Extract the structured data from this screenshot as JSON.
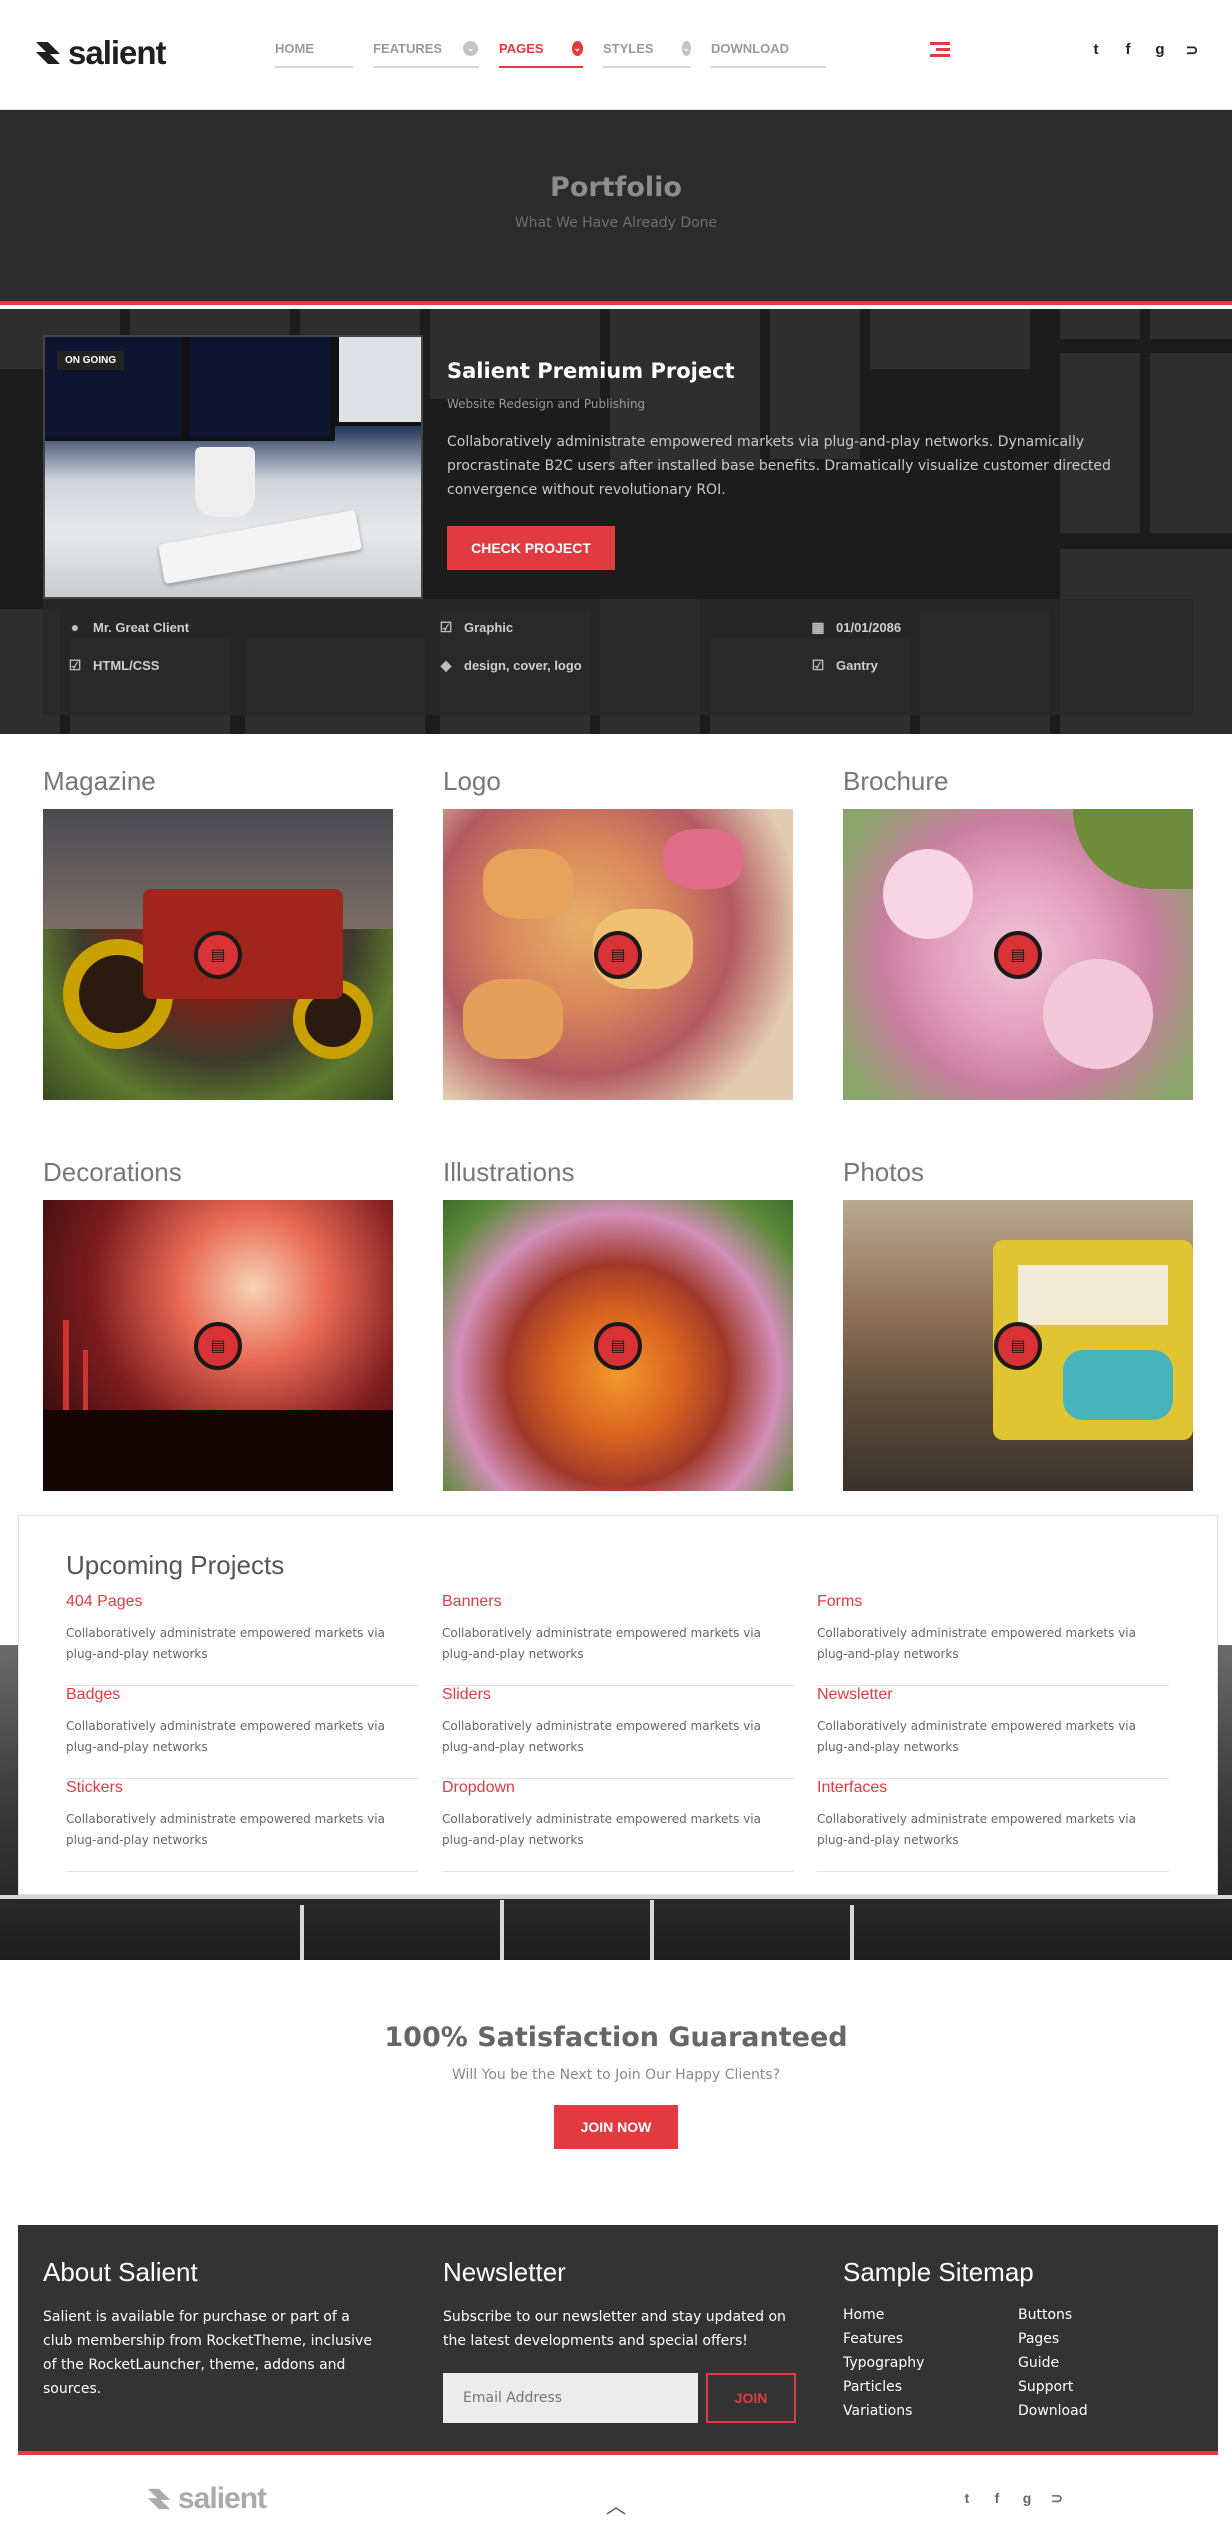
{
  "header": {
    "logo_text": "salient",
    "nav": [
      {
        "label": "HOME",
        "active": false,
        "has_dropdown": false
      },
      {
        "label": "FEATURES",
        "active": false,
        "has_dropdown": true
      },
      {
        "label": "PAGES",
        "active": true,
        "has_dropdown": true
      },
      {
        "label": "STYLES",
        "active": false,
        "has_dropdown": true
      },
      {
        "label": "DOWNLOAD",
        "active": false,
        "has_dropdown": false
      }
    ],
    "social_icons": [
      "twitter-icon",
      "facebook-icon",
      "google-plus-icon",
      "rss-icon"
    ],
    "social_glyphs": [
      "t",
      "f",
      "g",
      "⊃"
    ]
  },
  "banner": {
    "title": "Portfolio",
    "subtitle": "What We Have Already Done"
  },
  "featured": {
    "badge": "ON GOING",
    "title": "Salient Premium Project",
    "subtitle": "Website Redesign and Publishing",
    "description": "Collaboratively administrate empowered markets via plug-and-play networks. Dynamically procrastinate B2C users after installed base benefits. Dramatically visualize customer directed convergence without revolutionary ROI.",
    "button_label": "CHECK PROJECT",
    "meta": [
      {
        "icon": "user-icon",
        "text": "Mr. Great Client"
      },
      {
        "icon": "check-icon",
        "text": "Graphic"
      },
      {
        "icon": "calendar-icon",
        "text": "01/01/2086"
      },
      {
        "icon": "check-icon",
        "text": "HTML/CSS"
      },
      {
        "icon": "tag-icon",
        "text": "design, cover, logo"
      },
      {
        "icon": "check-icon",
        "text": "Gantry"
      }
    ]
  },
  "categories": [
    {
      "title": "Magazine",
      "image": "red tractor"
    },
    {
      "title": "Logo",
      "image": "candied pastries"
    },
    {
      "title": "Brochure",
      "image": "pink cherry blossoms"
    },
    {
      "title": "Decorations",
      "image": "fireworks over city"
    },
    {
      "title": "Illustrations",
      "image": "coneflower close-up"
    },
    {
      "title": "Photos",
      "image": "yellow graffiti tram"
    }
  ],
  "upcoming": {
    "title": "Upcoming Projects",
    "items": [
      {
        "title": "404 Pages",
        "desc": "Collaboratively administrate empowered markets via plug-and-play networks"
      },
      {
        "title": "Banners",
        "desc": "Collaboratively administrate empowered markets via plug-and-play networks"
      },
      {
        "title": "Forms",
        "desc": "Collaboratively administrate empowered markets via plug-and-play networks"
      },
      {
        "title": "Badges",
        "desc": "Collaboratively administrate empowered markets via plug-and-play networks"
      },
      {
        "title": "Sliders",
        "desc": "Collaboratively administrate empowered markets via plug-and-play networks"
      },
      {
        "title": "Newsletter",
        "desc": "Collaboratively administrate empowered markets via plug-and-play networks"
      },
      {
        "title": "Stickers",
        "desc": "Collaboratively administrate empowered markets via plug-and-play networks"
      },
      {
        "title": "Dropdown",
        "desc": "Collaboratively administrate empowered markets via plug-and-play networks"
      },
      {
        "title": "Interfaces",
        "desc": "Collaboratively administrate empowered markets via plug-and-play networks"
      }
    ]
  },
  "satisfaction": {
    "title": "100% Satisfaction Guaranteed",
    "subtitle": "Will You be the Next to Join Our Happy Clients?",
    "button_label": "JOIN NOW"
  },
  "footer": {
    "about_title": "About Salient",
    "about_text": "Salient is available for purchase or part of a club membership from RocketTheme, inclusive of the RocketLauncher, theme, addons and sources.",
    "newsletter_title": "Newsletter",
    "newsletter_text": "Subscribe to our newsletter and stay updated on the latest developments and special offers!",
    "email_placeholder": "Email Address",
    "join_label": "JOIN",
    "sitemap_title": "Sample Sitemap",
    "sitemap_col1": [
      "Home",
      "Features",
      "Typography",
      "Particles",
      "Variations"
    ],
    "sitemap_col2": [
      "Buttons",
      "Pages",
      "Guide",
      "Support",
      "Download"
    ]
  },
  "bottom": {
    "logo_text": "salient",
    "to_top_glyph": "︿",
    "social_glyphs": [
      "t",
      "f",
      "g",
      "⊃"
    ]
  },
  "colors": {
    "accent": "#e13b41",
    "dark": "#2b2b2b",
    "footer_bg": "#333333"
  }
}
